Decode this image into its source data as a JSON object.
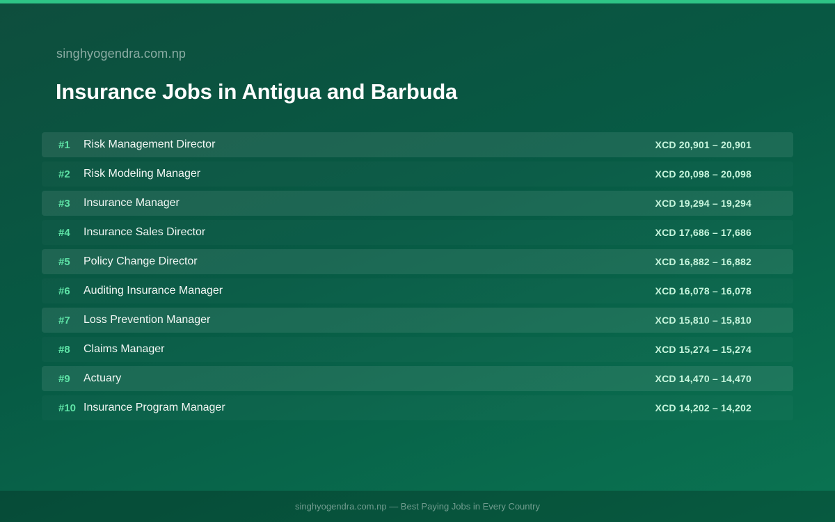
{
  "header": {
    "site_name": "singhyogendra.com.np",
    "title": "Insurance Jobs in Antigua and Barbuda"
  },
  "jobs": [
    {
      "rank": "#1",
      "title": "Risk Management Director",
      "salary": "XCD 20,901 – 20,901"
    },
    {
      "rank": "#2",
      "title": "Risk Modeling Manager",
      "salary": "XCD 20,098 – 20,098"
    },
    {
      "rank": "#3",
      "title": "Insurance Manager",
      "salary": "XCD 19,294 – 19,294"
    },
    {
      "rank": "#4",
      "title": "Insurance Sales Director",
      "salary": "XCD 17,686 – 17,686"
    },
    {
      "rank": "#5",
      "title": "Policy Change Director",
      "salary": "XCD 16,882 – 16,882"
    },
    {
      "rank": "#6",
      "title": "Auditing Insurance Manager",
      "salary": "XCD 16,078 – 16,078"
    },
    {
      "rank": "#7",
      "title": "Loss Prevention Manager",
      "salary": "XCD 15,810 – 15,810"
    },
    {
      "rank": "#8",
      "title": "Claims Manager",
      "salary": "XCD 15,274 – 15,274"
    },
    {
      "rank": "#9",
      "title": "Actuary",
      "salary": "XCD 14,470 – 14,470"
    },
    {
      "rank": "#10",
      "title": "Insurance Program Manager",
      "salary": "XCD 14,202 – 14,202"
    }
  ],
  "footer": {
    "text": "singhyogendra.com.np — Best Paying Jobs in Every Country"
  },
  "colors": {
    "accent": "#2ec486",
    "rank": "#5ee3a6",
    "salary": "#c7f5dd",
    "background": "#075a44"
  }
}
